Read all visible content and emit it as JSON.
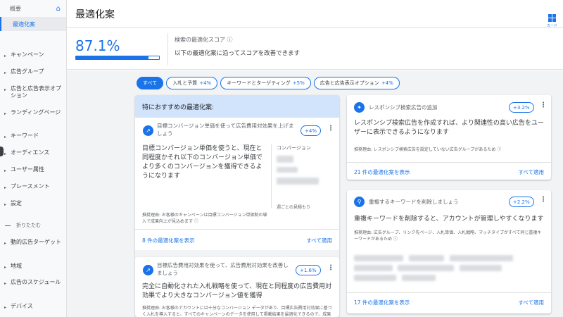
{
  "sidebar": {
    "overview": "概要",
    "active": "最適化案",
    "items": [
      {
        "label": "キャンペーン"
      },
      {
        "label": "広告グループ"
      },
      {
        "label": "広告と広告表示オプション"
      },
      {
        "label": "ランディングページ"
      },
      {
        "label": "キーワード"
      },
      {
        "label": "オーディエンス"
      },
      {
        "label": "ユーザー属性"
      },
      {
        "label": "プレースメント"
      },
      {
        "label": "設定"
      }
    ],
    "collapse": "折りたたむ",
    "more_items": [
      {
        "label": "動的広告ターゲット"
      },
      {
        "label": "地域"
      },
      {
        "label": "広告のスケジュール"
      },
      {
        "label": "デバイス"
      }
    ]
  },
  "header": {
    "title": "最適化案",
    "view_toggle": "カード"
  },
  "score": {
    "value": "87.1%",
    "fraction": 0.871,
    "label": "検索の最適化スコア ⓘ",
    "description": "以下の最適化案に沿ってスコアを改善できます"
  },
  "filters": [
    {
      "label": "すべて",
      "delta": ""
    },
    {
      "label": "入札と予算",
      "delta": "+4%"
    },
    {
      "label": "キーワードとターゲティング",
      "delta": "+5%"
    },
    {
      "label": "広告と広告表示オプション",
      "delta": "+4%"
    }
  ],
  "featured": {
    "heading": "特におすすめの最適化案:",
    "cards": [
      {
        "title": "目標コンバージョン単価を使って広告費用対効果を上げましょう",
        "delta": "+4%",
        "body": "目標コンバージョン単価を使うと、現在と同程度かそれ以下のコンバージョン単価でより多くのコンバージョンを獲得できるようになります",
        "reason": "推奨理由: お客様のキャンペーンは目標コンバージョン単価制の導入で成果向上が見込めます ⓘ",
        "side_label": "コンバージョン",
        "side_sub": "週ごとの見積もり",
        "link": "8 件の最適化案を表示",
        "apply": "すべて適用"
      },
      {
        "title": "目標広告費用対効果を使って、広告費用対効果を改善しましょう",
        "delta": "+1.6%",
        "body": "完全に自動化された入札戦略を使って、現在と同程度の広告費用対効果でより大きなコンバージョン値を獲得",
        "reason": "推奨理由: お客様のアカウントには十分なコンバージョン データがあり、目標広告費用対効果に基づく入札を導入すると、すべてのキャンペーンのデータを使用して掲載結果を最適化できるので、成果の向上が見込めます ⓘ"
      }
    ]
  },
  "right_cards": [
    {
      "title": "レスポンシブ検索広告の追加",
      "delta": "+3.2%",
      "body": "レスポンシブ検索広告を作成すれば、より関連性の高い広告をユーザーに表示できるようになります",
      "reason": "推奨理由: レスポンシブ検索広告を設定していない広告グループがあるため ⓘ",
      "link": "21 件の最適化案を表示",
      "apply": "すべて適用"
    },
    {
      "title": "重複するキーワードを削除しましょう",
      "delta": "+2.2%",
      "body": "重複キーワードを削除すると、アカウントが管理しやすくなります",
      "reason": "推奨理由: 広告グループ、リンク先ページ、入札単価、入札戦略、マッチタイプがすべて同じ重複キーワードがあるため ⓘ",
      "link": "17 件の最適化案を表示",
      "apply": "すべて適用"
    }
  ],
  "icons": {
    "home": "home-icon",
    "trend": "trend-icon",
    "rsa": "responsive-ads-icon",
    "search": "search-icon",
    "more": "more-vert-icon"
  },
  "colors": {
    "accent": "#1a73e8",
    "featured_header": "#d2e3fc"
  }
}
